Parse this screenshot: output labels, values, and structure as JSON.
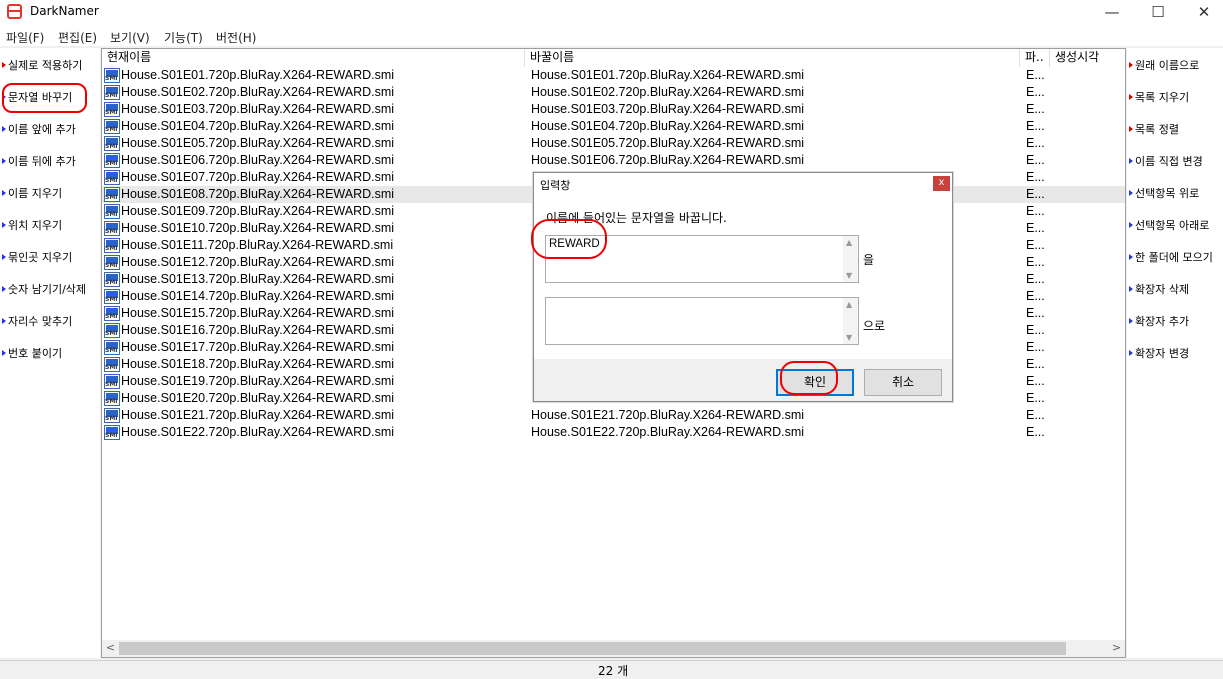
{
  "window": {
    "title": "DarkNamer",
    "minimize": "—",
    "maximize": "☐",
    "close": "✕"
  },
  "menu": [
    "파일(F)",
    "편집(E)",
    "보기(V)",
    "기능(T)",
    "버전(H)"
  ],
  "left_actions": [
    "실제로 적용하기",
    "문자열 바꾸기",
    "이름 앞에 추가",
    "이름 뒤에 추가",
    "이름 지우기",
    "위치 지우기",
    "묶인곳 지우기",
    "숫자 남기기/삭제",
    "자리수 맞추기",
    "번호 붙이기"
  ],
  "right_actions": [
    "원래 이름으로",
    "목록 지우기",
    "목록 정렬",
    "이름 직접 변경",
    "선택항목 위로",
    "선택항목 아래로",
    "한 폴더에 모으기",
    "확장자 삭제",
    "확장자 추가",
    "확장자 변경"
  ],
  "columns": {
    "current": "현재이름",
    "new": "바꿀이름",
    "ext": "파..",
    "created": "생성시각"
  },
  "files": [
    {
      "current": "House.S01E01.720p.BluRay.X264-REWARD.smi",
      "new": "House.S01E01.720p.BluRay.X264-REWARD.smi",
      "ext": "E..."
    },
    {
      "current": "House.S01E02.720p.BluRay.X264-REWARD.smi",
      "new": "House.S01E02.720p.BluRay.X264-REWARD.smi",
      "ext": "E..."
    },
    {
      "current": "House.S01E03.720p.BluRay.X264-REWARD.smi",
      "new": "House.S01E03.720p.BluRay.X264-REWARD.smi",
      "ext": "E..."
    },
    {
      "current": "House.S01E04.720p.BluRay.X264-REWARD.smi",
      "new": "House.S01E04.720p.BluRay.X264-REWARD.smi",
      "ext": "E..."
    },
    {
      "current": "House.S01E05.720p.BluRay.X264-REWARD.smi",
      "new": "House.S01E05.720p.BluRay.X264-REWARD.smi",
      "ext": "E..."
    },
    {
      "current": "House.S01E06.720p.BluRay.X264-REWARD.smi",
      "new": "House.S01E06.720p.BluRay.X264-REWARD.smi",
      "ext": "E..."
    },
    {
      "current": "House.S01E07.720p.BluRay.X264-REWARD.smi",
      "new": "H",
      "ext": "E..."
    },
    {
      "current": "House.S01E08.720p.BluRay.X264-REWARD.smi",
      "new": "H",
      "ext": "E..."
    },
    {
      "current": "House.S01E09.720p.BluRay.X264-REWARD.smi",
      "new": "H",
      "ext": "E..."
    },
    {
      "current": "House.S01E10.720p.BluRay.X264-REWARD.smi",
      "new": "H",
      "ext": "E..."
    },
    {
      "current": "House.S01E11.720p.BluRay.X264-REWARD.smi",
      "new": "H",
      "ext": "E..."
    },
    {
      "current": "House.S01E12.720p.BluRay.X264-REWARD.smi",
      "new": "H",
      "ext": "E..."
    },
    {
      "current": "House.S01E13.720p.BluRay.X264-REWARD.smi",
      "new": "H",
      "ext": "E..."
    },
    {
      "current": "House.S01E14.720p.BluRay.X264-REWARD.smi",
      "new": "H",
      "ext": "E..."
    },
    {
      "current": "House.S01E15.720p.BluRay.X264-REWARD.smi",
      "new": "H",
      "ext": "E..."
    },
    {
      "current": "House.S01E16.720p.BluRay.X264-REWARD.smi",
      "new": "H",
      "ext": "E..."
    },
    {
      "current": "House.S01E17.720p.BluRay.X264-REWARD.smi",
      "new": "H",
      "ext": "E..."
    },
    {
      "current": "House.S01E18.720p.BluRay.X264-REWARD.smi",
      "new": "H",
      "ext": "E..."
    },
    {
      "current": "House.S01E19.720p.BluRay.X264-REWARD.smi",
      "new": "H",
      "ext": "E..."
    },
    {
      "current": "House.S01E20.720p.BluRay.X264-REWARD.smi",
      "new": "H",
      "ext": "E..."
    },
    {
      "current": "House.S01E21.720p.BluRay.X264-REWARD.smi",
      "new": "House.S01E21.720p.BluRay.X264-REWARD.smi",
      "ext": "E..."
    },
    {
      "current": "House.S01E22.720p.BluRay.X264-REWARD.smi",
      "new": "House.S01E22.720p.BluRay.X264-REWARD.smi",
      "ext": "E..."
    }
  ],
  "selected_row_index": 7,
  "status": {
    "count": "22 개"
  },
  "dialog": {
    "title": "입력창",
    "close": "x",
    "message": "이름에 들어있는 문자열을 바꿉니다.",
    "find_value": "REWARD",
    "find_suffix": "을",
    "replace_value": "",
    "replace_suffix": "으로",
    "ok": "확인",
    "cancel": "취소"
  },
  "colors": {
    "accent": "#0078d7",
    "arrow": "#1a3be0",
    "annotation": "#e00000"
  }
}
